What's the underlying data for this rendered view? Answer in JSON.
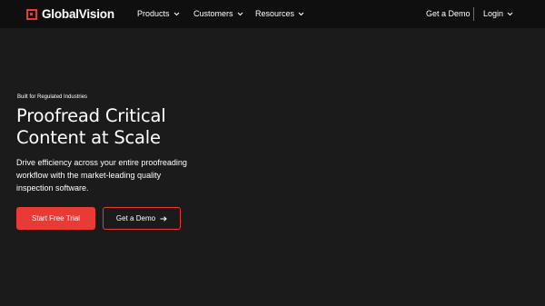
{
  "nav": {
    "brand": "GlobalVision",
    "items": [
      {
        "label": "Products"
      },
      {
        "label": "Customers"
      },
      {
        "label": "Resources"
      }
    ],
    "demo_label": "Get a Demo",
    "login_label": "Login",
    "accent_color": "#e93a36"
  },
  "hero": {
    "eyebrow": "Built for Regulated Industries",
    "headline_lines": [
      "Proofread Critical",
      "Content at Scale"
    ],
    "subtext_lines": [
      "Drive efficiency across your entire proofreading",
      "workflow with the market-leading quality",
      "inspection software."
    ],
    "primary_cta": "Start Free Trial",
    "secondary_cta": "Get a Demo",
    "secondary_cta_icon": "arrow-right-icon"
  }
}
